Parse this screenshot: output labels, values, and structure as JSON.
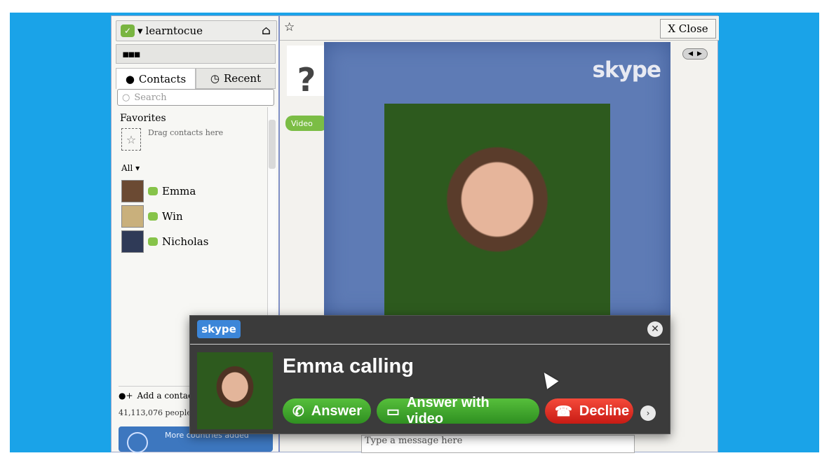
{
  "sidebar": {
    "username": "learntocue",
    "tabs": [
      {
        "label": "Contacts"
      },
      {
        "label": "Recent"
      }
    ],
    "search_placeholder": "Search",
    "favorites_title": "Favorites",
    "favorites_hint": "Drag contacts here",
    "all_label": "All",
    "contacts": [
      {
        "name": "Emma"
      },
      {
        "name": "Win"
      },
      {
        "name": "Nicholas"
      }
    ],
    "add_contact": "Add a contact",
    "people_online": "41,113,076 people",
    "promo_text": "More countries added"
  },
  "main": {
    "close_label": "Close",
    "video_label": "Video",
    "message_placeholder": "Type a message here"
  },
  "video_frame": {
    "logo_text": "skype"
  },
  "incoming_call": {
    "logo_text": "skype",
    "caller_text": "Emma calling",
    "buttons": {
      "answer": "Answer",
      "answer_video": "Answer with video",
      "decline": "Decline"
    }
  },
  "colors": {
    "backdrop": "#1aa3e8",
    "answer_green": "#3aa12a",
    "decline_red": "#e0271d",
    "popup_bg": "#3b3b3b"
  }
}
